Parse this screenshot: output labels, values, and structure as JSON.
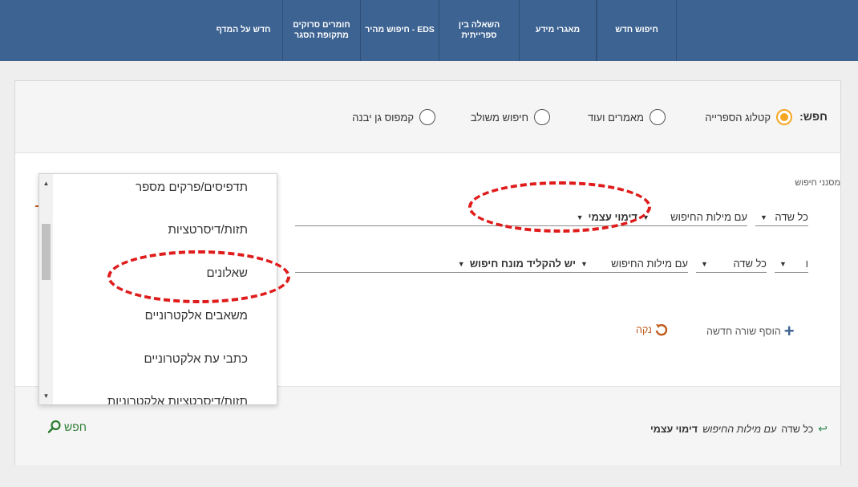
{
  "nav": {
    "items": [
      {
        "label": "חיפוש חדש"
      },
      {
        "label": "מאגרי מידע"
      },
      {
        "label": "השאלה בין ספרייתית"
      },
      {
        "label": "EDS - חיפוש מהיר"
      },
      {
        "label": "חומרים סרוקים מתקופת הסגר"
      },
      {
        "label": "חדש על המדף"
      }
    ]
  },
  "search_scope": {
    "label": "חפש:",
    "options": [
      {
        "label": "קטלוג הספרייה",
        "checked": true
      },
      {
        "label": "מאמרים ועוד",
        "checked": false
      },
      {
        "label": "חיפוש משולב",
        "checked": false
      },
      {
        "label": "קמפוס גן יבנה",
        "checked": false
      }
    ]
  },
  "filters": {
    "title": "מסנני חיפוש",
    "row1": {
      "field": "כל שדה",
      "operator": "עם מילות החיפוש",
      "value": "דימוי עצמי"
    },
    "row2": {
      "boolean": "ו",
      "field": "כל שדה",
      "operator": "עם מילות החיפוש",
      "value_placeholder": "יש להקליד מונח חיפוש"
    },
    "add_row": "הוסף שורה חדשה",
    "clear": "נקה"
  },
  "summary": {
    "field": "כל שדה",
    "operator": "עם מילות החיפוש",
    "value": "דימוי עצמי"
  },
  "search_button": "חפש",
  "dropdown": {
    "items": [
      "תדפיסים/פרקים מספר",
      "תזות/דיסרטציות",
      "שאלונים",
      "משאבים אלקטרוניים",
      "כתבי עת אלקטרוניים",
      "תזות/דיסרטציות אלקטרוניות"
    ]
  },
  "colors": {
    "nav_bg": "#3d6392",
    "radio_accent": "#f5a623",
    "annotation": "#e01b1b",
    "search_green": "#2e7d32"
  }
}
